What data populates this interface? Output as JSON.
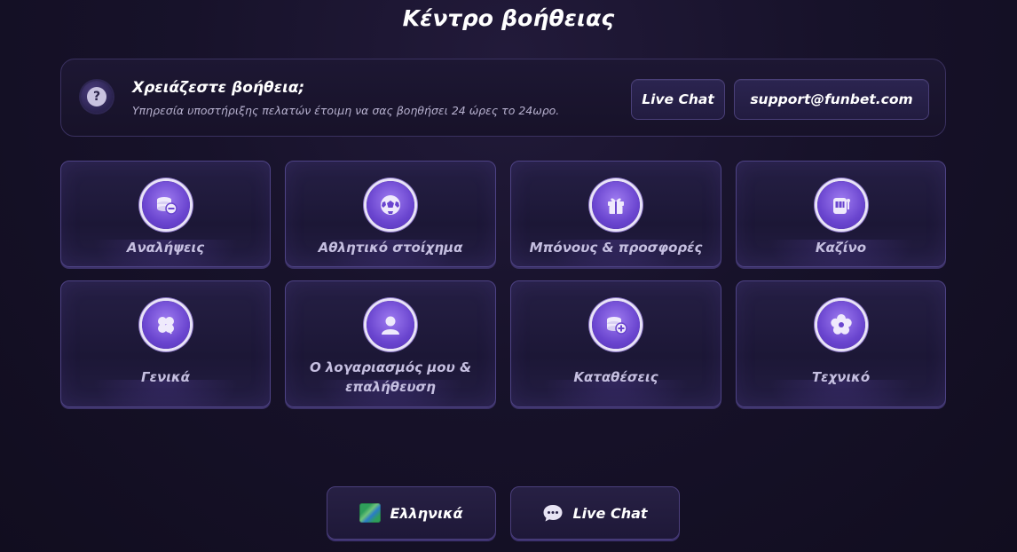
{
  "page": {
    "title": "Κέντρο βοήθειας"
  },
  "help_banner": {
    "title": "Χρειάζεστε βοήθεια;",
    "subtitle": "Υπηρεσία υποστήριξης πελατών έτοιμη να σας βοηθήσει 24 ώρες το 24ωρο.",
    "live_chat_label": "Live Chat",
    "email_label": "support@funbet.com",
    "icon": "question-icon"
  },
  "categories": [
    {
      "label": "Αναλήψεις",
      "icon": "coins-minus-icon"
    },
    {
      "label": "Αθλητικό στοίχημα",
      "icon": "football-icon"
    },
    {
      "label": "Μπόνους & προσφορές",
      "icon": "gift-icon"
    },
    {
      "label": "Καζίνο",
      "icon": "slot-machine-icon"
    },
    {
      "label": "Γενικά",
      "icon": "clover-icon"
    },
    {
      "label": "Ο λογαριασμός μου & επαλήθευση",
      "icon": "user-icon"
    },
    {
      "label": "Καταθέσεις",
      "icon": "coins-plus-icon"
    },
    {
      "label": "Τεχνικό",
      "icon": "gear-icon"
    }
  ],
  "footer": {
    "language_label": "Ελληνικά",
    "language_icon": "globe-flag-icon",
    "live_chat_label": "Live Chat",
    "live_chat_icon": "chat-bubble-icon"
  },
  "colors": {
    "background": "#15112a",
    "tile_border": "#4e4385",
    "icon_purple": "#6a45cf",
    "label_text": "#c5bfe0"
  }
}
